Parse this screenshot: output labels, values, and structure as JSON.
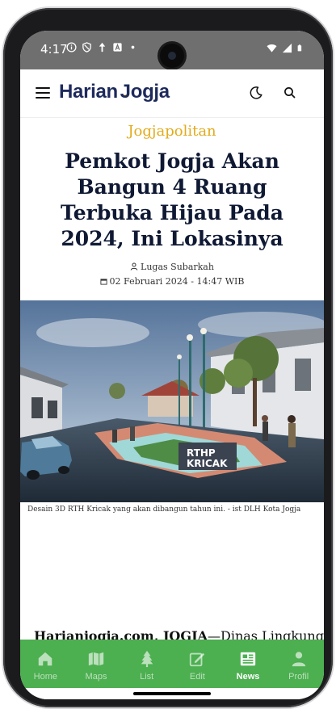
{
  "status_bar": {
    "time": "4:17",
    "icons_left": [
      "info-icon",
      "shield-icon",
      "data-saver-icon",
      "a-box-icon",
      "dot-icon"
    ],
    "icons_right": [
      "wifi-icon",
      "signal-icon",
      "battery-icon"
    ]
  },
  "header": {
    "brand_part1": "Harian",
    "brand_part2": "Jogja",
    "brand_accent_color": "#f2b203",
    "brand_color": "#1e2a5c",
    "icons": [
      "menu-icon",
      "dark-mode-icon",
      "search-icon"
    ]
  },
  "article": {
    "category": "Jogjapolitan",
    "title": "Pemkot Jogja Akan Bangun 4 Ruang Terbuka Hijau Pada 2024, Ini Lokasinya",
    "author": "Lugas Subarkah",
    "date": "02 Februari 2024 - 14:47 WIB",
    "image_sign": [
      "RTHP",
      "KRICAK"
    ],
    "caption": "Desain 3D RTH Kricak yang akan dibangun tahun ini. - ist DLH Kota Jogja",
    "lead_source": "Harianjogja.com, JOGJA",
    "lead_text": "—Dinas Lingkungan"
  },
  "bottom_nav": {
    "color": "#4caf50",
    "items": [
      {
        "label": "Home",
        "icon": "home-icon"
      },
      {
        "label": "Maps",
        "icon": "map-icon"
      },
      {
        "label": "List",
        "icon": "tree-icon"
      },
      {
        "label": "Edit",
        "icon": "edit-icon"
      },
      {
        "label": "News",
        "icon": "newspaper-icon",
        "active": true
      },
      {
        "label": "Profil",
        "icon": "person-icon"
      }
    ]
  }
}
